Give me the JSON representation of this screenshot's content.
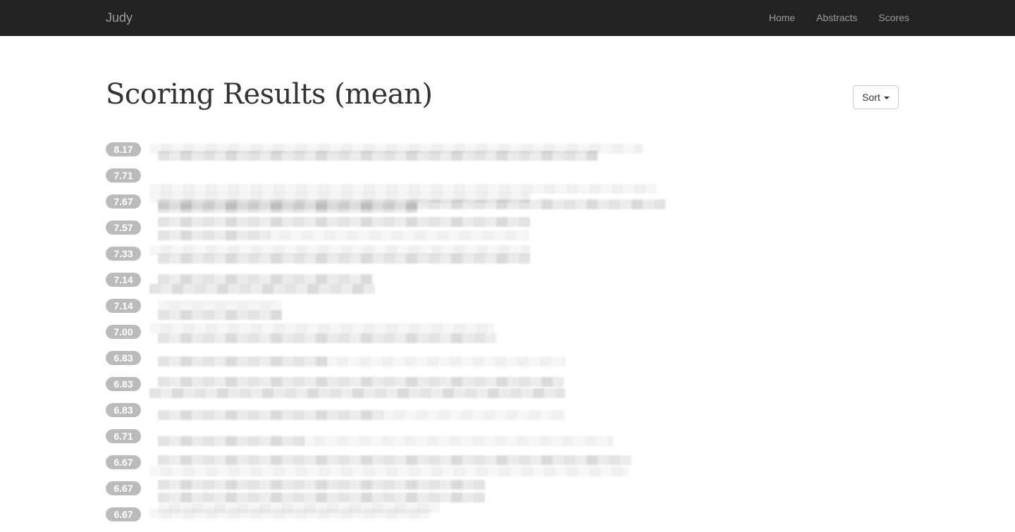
{
  "navbar": {
    "brand": "Judy",
    "links": [
      {
        "label": "Home"
      },
      {
        "label": "Abstracts"
      },
      {
        "label": "Scores"
      }
    ]
  },
  "page": {
    "title": "Scoring Results (mean)",
    "sort_label": "Sort"
  },
  "results": [
    {
      "score": "8.17",
      "title": ""
    },
    {
      "score": "7.71",
      "title": ""
    },
    {
      "score": "7.67",
      "title": ""
    },
    {
      "score": "7.57",
      "title": ""
    },
    {
      "score": "7.33",
      "title": ""
    },
    {
      "score": "7.14",
      "title": ""
    },
    {
      "score": "7.14",
      "title": ""
    },
    {
      "score": "7.00",
      "title": ""
    },
    {
      "score": "6.83",
      "title": ""
    },
    {
      "score": "6.83",
      "title": ""
    },
    {
      "score": "6.83",
      "title": ""
    },
    {
      "score": "6.71",
      "title": ""
    },
    {
      "score": "6.67",
      "title": ""
    },
    {
      "score": "6.67",
      "title": ""
    },
    {
      "score": "6.67",
      "title": ""
    }
  ]
}
